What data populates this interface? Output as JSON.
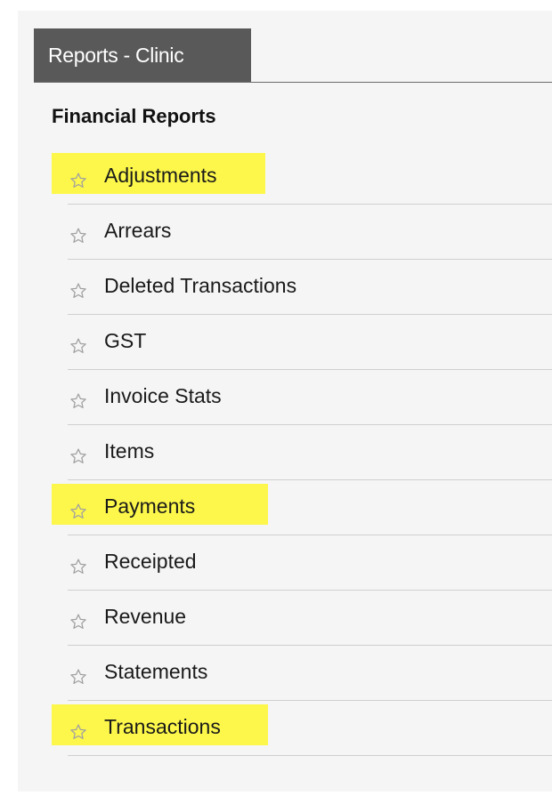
{
  "tab": {
    "label": "Reports - Clinic"
  },
  "section": {
    "title": "Financial Reports"
  },
  "colors": {
    "highlight": "#fcf74a",
    "tab_background": "#595959",
    "panel_background": "#f5f5f5"
  },
  "reports": [
    {
      "label": "Adjustments",
      "highlighted": true,
      "icon": "star-outline-icon"
    },
    {
      "label": "Arrears",
      "highlighted": false,
      "icon": "star-outline-icon"
    },
    {
      "label": "Deleted Transactions",
      "highlighted": false,
      "icon": "star-outline-icon"
    },
    {
      "label": "GST",
      "highlighted": false,
      "icon": "star-outline-icon"
    },
    {
      "label": "Invoice Stats",
      "highlighted": false,
      "icon": "star-outline-icon"
    },
    {
      "label": "Items",
      "highlighted": false,
      "icon": "star-outline-icon"
    },
    {
      "label": "Payments",
      "highlighted": true,
      "icon": "star-outline-icon"
    },
    {
      "label": "Receipted",
      "highlighted": false,
      "icon": "star-outline-icon"
    },
    {
      "label": "Revenue",
      "highlighted": false,
      "icon": "star-outline-icon"
    },
    {
      "label": "Statements",
      "highlighted": false,
      "icon": "star-outline-icon"
    },
    {
      "label": "Transactions",
      "highlighted": true,
      "icon": "star-outline-icon"
    }
  ]
}
